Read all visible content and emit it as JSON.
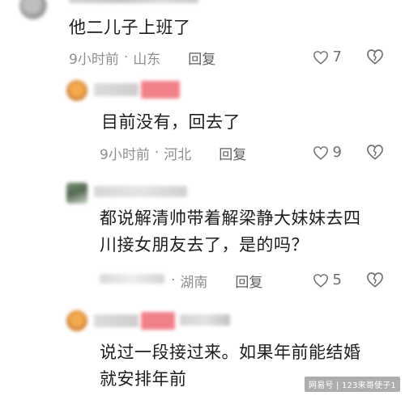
{
  "comments": [
    {
      "text_lines": [
        "他二儿子上班了"
      ],
      "time": "9小时前",
      "location": "山东",
      "reply_label": "回复",
      "likes": "7"
    },
    {
      "text_lines": [
        "目前没有，回去了"
      ],
      "time": "9小时前",
      "location": "河北",
      "reply_label": "回复",
      "likes": "9"
    },
    {
      "text_lines": [
        "都说解清帅带着解梁静大妹妹去四",
        "川接女朋友去了，是的吗？"
      ],
      "time": "",
      "location": "湖南",
      "reply_label": "回复",
      "likes": "5"
    },
    {
      "text_lines": [
        "说过一段接过来。如果年前能结婚",
        "就安排年前"
      ]
    }
  ],
  "separator": "·",
  "watermark": "网易号 | 123来哥使子1",
  "colors": {
    "text": "#1d1d1f",
    "meta": "#8e8e93",
    "reply": "#5f5f63",
    "badge": "#f0737d"
  },
  "icons": {
    "like": "heart-outline-icon",
    "dislike": "broken-heart-icon"
  }
}
